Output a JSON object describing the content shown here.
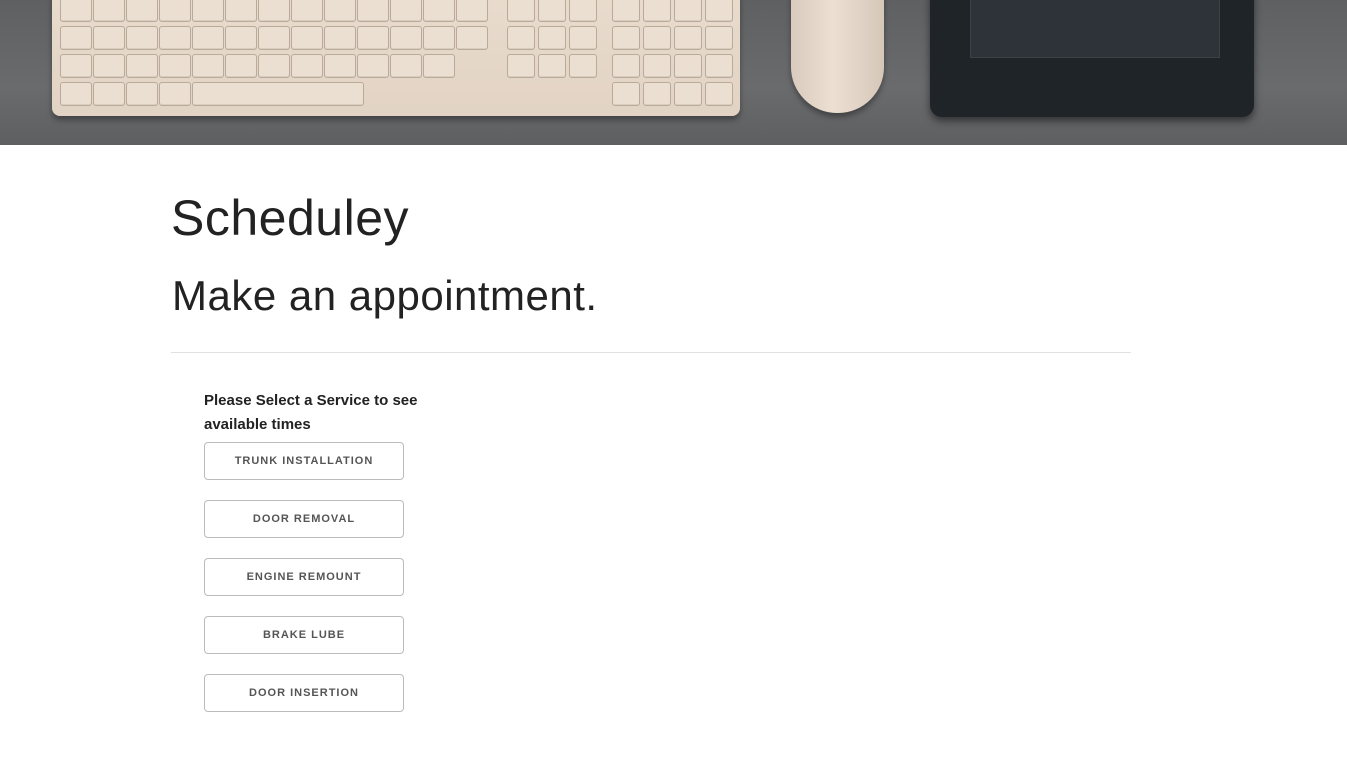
{
  "header": {
    "app_title": "Scheduley",
    "page_heading": "Make an appointment."
  },
  "services": {
    "prompt": "Please Select a Service to see available times",
    "items": [
      {
        "label": "TRUNK INSTALLATION"
      },
      {
        "label": "DOOR REMOVAL"
      },
      {
        "label": "ENGINE REMOUNT"
      },
      {
        "label": "BRAKE LUBE"
      },
      {
        "label": "DOOR INSERTION"
      }
    ]
  },
  "theme": {
    "text_color": "#222222",
    "button_text_color": "#555555",
    "button_border_color": "#bbbbbb",
    "divider_color": "#e1e1e1"
  }
}
